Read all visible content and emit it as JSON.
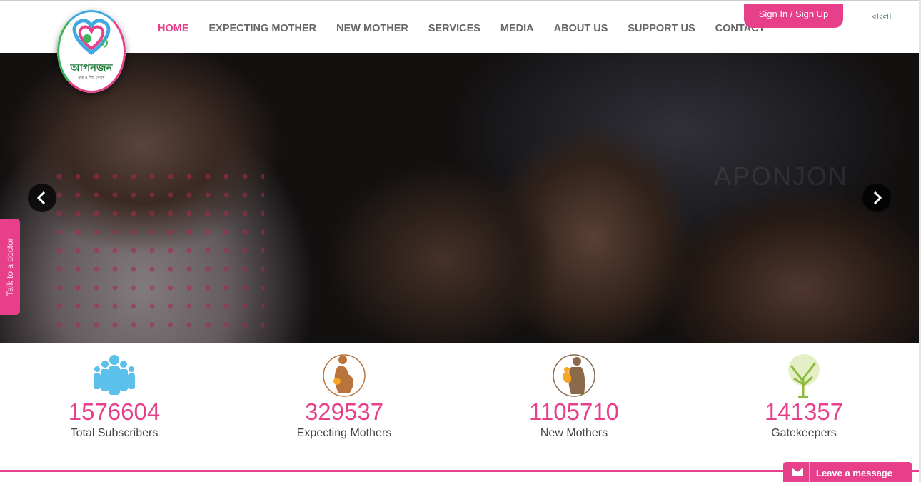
{
  "logo": {
    "text": "আপনজন",
    "tagline": "মাতৃ ও শিশু সেবায়"
  },
  "nav": {
    "items": [
      "HOME",
      "EXPECTING MOTHER",
      "NEW MOTHER",
      "SERVICES",
      "MEDIA",
      "ABOUT US",
      "SUPPORT US",
      "CONTACT"
    ],
    "active": "HOME"
  },
  "header": {
    "signin_label": "Sign In / Sign Up",
    "language": "বাংলা"
  },
  "hero": {
    "watermark": "APONJON",
    "prev_icon": "chevron-left-icon",
    "next_icon": "chevron-right-icon"
  },
  "sidebar_tab": {
    "label": "Talk to a doctor"
  },
  "stats": [
    {
      "value": "1576604",
      "label": "Total Subscribers",
      "icon": "people-group-icon"
    },
    {
      "value": "329537",
      "label": "Expecting Mothers",
      "icon": "pregnant-mother-icon"
    },
    {
      "value": "1105710",
      "label": "New Mothers",
      "icon": "mother-child-icon"
    },
    {
      "value": "141357",
      "label": "Gatekeepers",
      "icon": "tree-icon"
    }
  ],
  "chat": {
    "label": "Leave a message",
    "icon": "envelope-icon"
  },
  "colors": {
    "accent": "#e83f8a",
    "green": "#1e7b3a",
    "blue": "#5bc0eb",
    "brown": "#b8743c"
  }
}
